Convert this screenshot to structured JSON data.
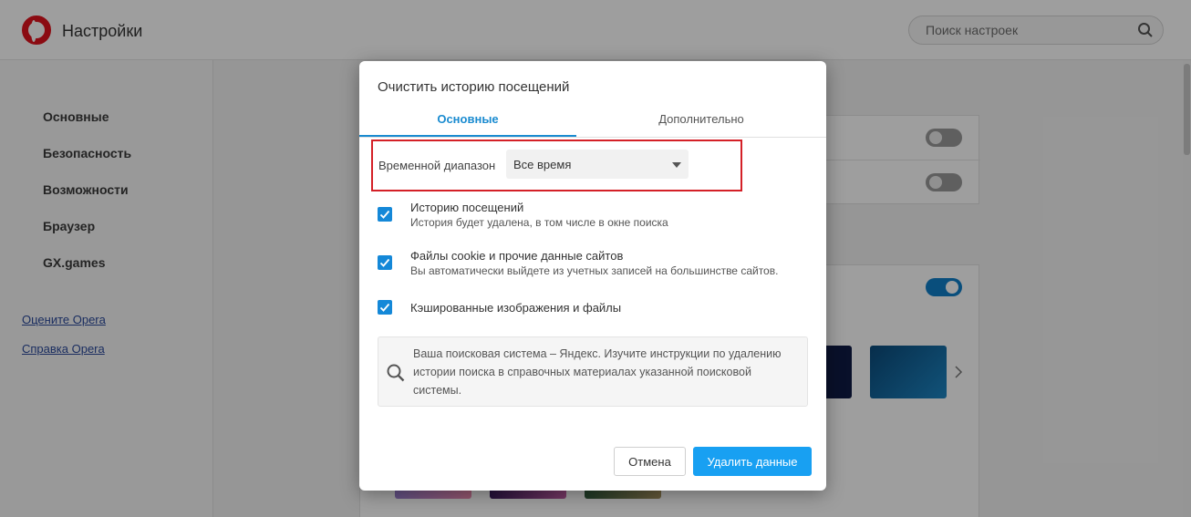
{
  "app": {
    "title": "Настройки"
  },
  "search": {
    "placeholder": "Поиск настроек",
    "value": ""
  },
  "sidebar": {
    "items": [
      {
        "label": "Основные"
      },
      {
        "label": "Безопасность"
      },
      {
        "label": "Возможности"
      },
      {
        "label": "Браузер"
      },
      {
        "label": "GX.games"
      }
    ],
    "links": [
      {
        "label": "Оцените Opera"
      },
      {
        "label": "Справка Opera"
      }
    ]
  },
  "dialog": {
    "title": "Очистить историю посещений",
    "tabs": [
      {
        "label": "Основные",
        "active": true
      },
      {
        "label": "Дополнительно",
        "active": false
      }
    ],
    "time_range": {
      "label": "Временной диапазон",
      "selected": "Все время"
    },
    "options": [
      {
        "label": "Историю посещений",
        "sub": "История будет удалена, в том числе в окне поиска",
        "checked": true
      },
      {
        "label": "Файлы cookie и прочие данные сайтов",
        "sub": "Вы автоматически выйдете из учетных записей на большинстве сайтов.",
        "checked": true
      },
      {
        "label": "Кэшированные изображения и файлы",
        "sub": "",
        "checked": true
      }
    ],
    "info": "Ваша поисковая система – Яндекс. Изучите инструкции по удалению истории поиска в справочных материалах указанной поисковой системы.",
    "buttons": {
      "cancel": "Отмена",
      "delete": "Удалить данные"
    }
  },
  "colors": {
    "accent": "#1a8bd0",
    "primary_button": "#18a0f2",
    "highlight_border": "#d42027",
    "opera_red": "#e0131e"
  },
  "icons": [
    "opera-logo-icon",
    "search-icon",
    "checkmark-icon",
    "chevron-down-icon",
    "chevron-right-icon"
  ]
}
